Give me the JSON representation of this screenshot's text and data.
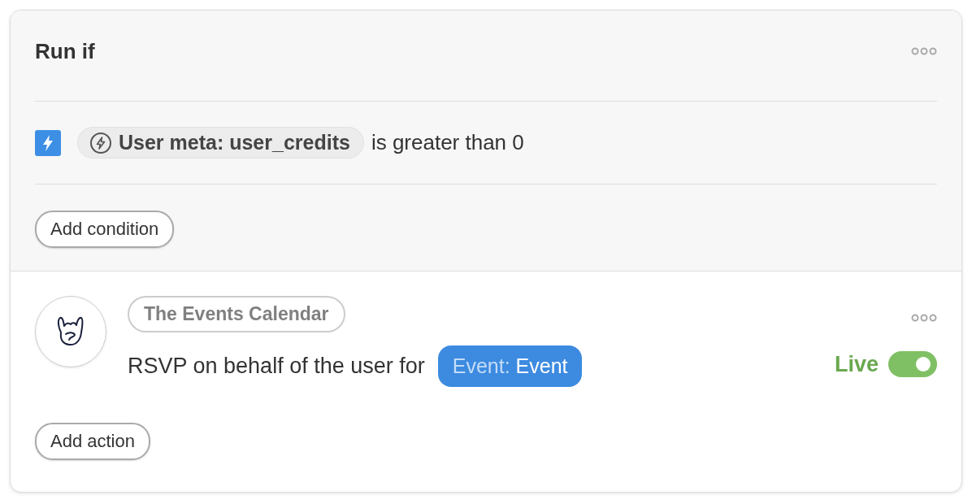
{
  "condition_section": {
    "title": "Run if",
    "conditions": [
      {
        "token": "User meta: user_credits",
        "operator": "is greater than 0"
      }
    ],
    "add_button": "Add condition"
  },
  "action": {
    "integration": "The Events Calendar",
    "description": "RSVP on behalf of the user for",
    "tag": {
      "prefix": "Event:",
      "value": "Event"
    },
    "status": "Live",
    "live": true
  },
  "add_action_button": "Add action"
}
